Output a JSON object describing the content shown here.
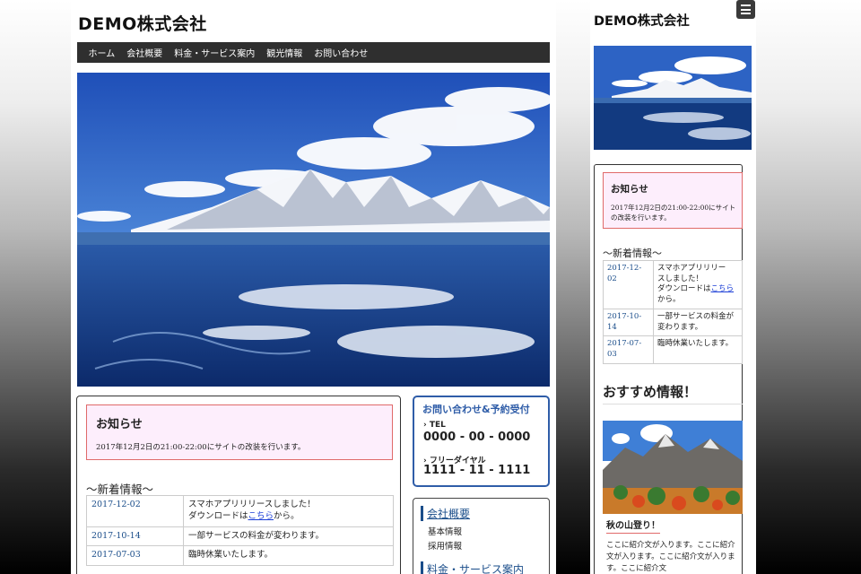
{
  "site": {
    "logo": "DEMO株式会社"
  },
  "nav": [
    "ホーム",
    "会社概要",
    "料金・サービス案内",
    "観光情報",
    "お問い合わせ"
  ],
  "notice": {
    "title": "お知らせ",
    "text": "2017年12月2日の21:00-22:00にサイトの改装を行います。"
  },
  "news": {
    "heading": "〜新着情報〜",
    "items": [
      {
        "date": "2017-12-02",
        "line1": "スマホアプリリリースしました！",
        "pre": "ダウンロードは",
        "link": "こちら",
        "post": "から。"
      },
      {
        "date": "2017-10-14",
        "text": "一部サービスの料金が変わります。"
      },
      {
        "date": "2017-07-03",
        "text": "臨時休業いたします。"
      }
    ]
  },
  "contact": {
    "title": "お問い合わせ&予約受付",
    "tel_label": "TEL",
    "tel": "0000 - 00 - 0000",
    "free_label": "フリーダイヤル",
    "free": "1111 - 11 - 1111"
  },
  "side_menu": {
    "company": "会社概要",
    "company_items": [
      "基本情報",
      "採用情報"
    ],
    "services": "料金・サービス案内"
  },
  "mobile": {
    "logo": "DEMO株式会社",
    "notice_title": "お知らせ",
    "notice_text": "2017年12月2日の21:00-22:00にサイトの改装を行います。",
    "news_heading": "〜新着情報〜",
    "news": [
      {
        "date": "2017-12-02",
        "line1": "スマホアプリリリー",
        "line2": "スしました！",
        "pre": "ダウンロードは",
        "link": "こちら",
        "post": "から。"
      },
      {
        "date": "2017-10-14",
        "text": "一部サービスの料金が変わります。"
      },
      {
        "date": "2017-07-03",
        "text": "臨時休業いたします。"
      }
    ],
    "recommend_heading": "おすすめ情報！",
    "recommend_title": "秋の山登り！",
    "recommend_text": "ここに紹介文が入ります。ここに紹介文が入ります。ここに紹介文が入ります。ここに紹介文"
  },
  "colors": {
    "nav_bg": "#2f2f2f",
    "accent_blue": "#2f5da8",
    "notice_bg": "#fdeefc",
    "notice_border": "#e06a6a"
  },
  "icons": [
    "hamburger-menu-icon",
    "chevron-right-icon"
  ]
}
